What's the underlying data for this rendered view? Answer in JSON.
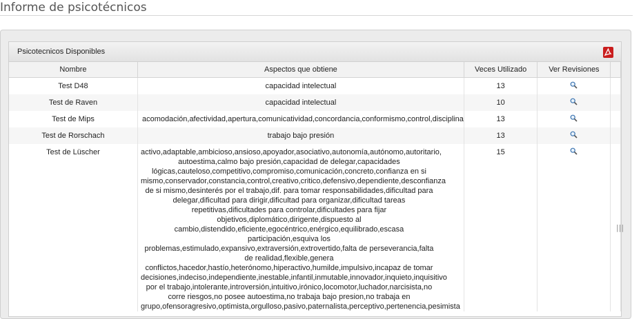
{
  "page": {
    "title": "Informe de psicotécnicos"
  },
  "panel": {
    "caption": "Psicotecnicos Disponibles",
    "export_icon": "pdf-icon"
  },
  "table": {
    "headers": [
      "Nombre",
      "Aspectos que obtiene",
      "Veces Utilizado",
      "Ver Revisiones"
    ],
    "rows": [
      {
        "name": "Test D48",
        "aspects": "capacidad intelectual",
        "uses": "13",
        "review_icon": "magnifier-icon"
      },
      {
        "name": "Test de Raven",
        "aspects": "capacidad intelectual",
        "uses": "10",
        "review_icon": "magnifier-icon"
      },
      {
        "name": "Test de Mips",
        "aspects": "acomodación,afectividad,apertura,comunicatividad,concordancia,conformismo,control,disciplina",
        "uses": "13",
        "review_icon": "magnifier-icon"
      },
      {
        "name": "Test de Rorschach",
        "aspects": "trabajo bajo presión",
        "uses": "13",
        "review_icon": "magnifier-icon"
      },
      {
        "name": "Test de Lüscher",
        "aspects": "activo,adaptable,ambicioso,ansioso,apoyador,asociativo,autonomía,autónomo,autoritario, autoestima,calmo bajo presión,capacidad de delegar,capacidades lógicas,cauteloso,competitivo,compromiso,comunicación,concreto,confianza en si mismo,conservador,constancia,control,creativo,critico,defensivo,dependiente,desconfianza de si mismo,desinterés por el trabajo,dif. para tomar responsabilidades,dificultad para delegar,dificultad para dirigir,dificultad para organizar,dificultad tareas repetitivas,dificultades para controlar,dificultades para fijar objetivos,diplomático,dirigente,dispuesto al cambio,distendido,eficiente,egocéntrico,enérgico,equilibrado,escasa participación,esquiva los problemas,estimulado,expansivo,extraversión,extrovertido,falta de perseverancia,falta de realidad,flexible,genera conflictos,hacedor,hastío,heterónomo,hiperactivo,humilde,impulsivo,incapaz de tomar decisiones,indeciso,independiente,inestable,infantil,inmutable,innovador,inquieto,inquisitivo por el trabajo,intolerante,introversión,intuitivo,irónico,locomotor,luchador,narcisista,no corre riesgos,no posee autoestima,no trabaja bajo presion,no trabaja en grupo,ofensoragresivo,optimista,orgulloso,pasivo,paternalista,perceptivo,pertenencia,pesimista",
        "uses": "15",
        "review_icon": "magnifier-icon"
      }
    ]
  }
}
